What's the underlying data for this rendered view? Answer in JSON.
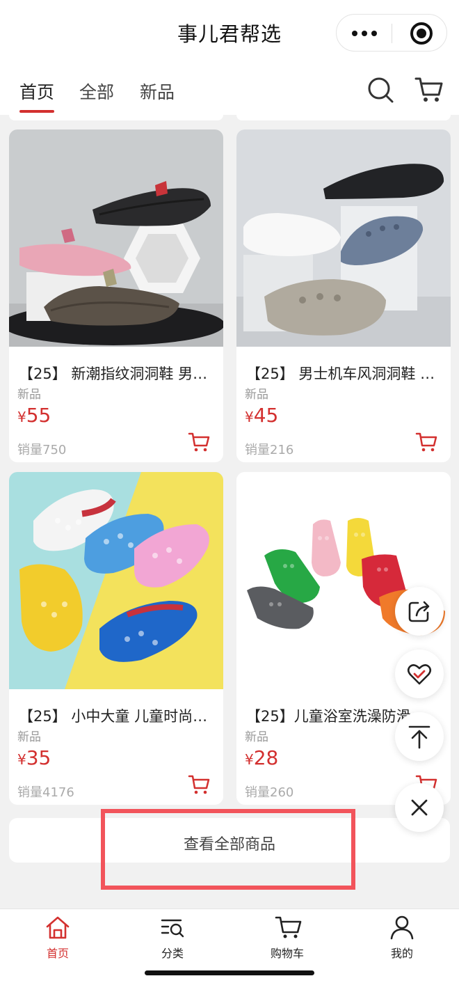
{
  "header": {
    "title": "事儿君帮选"
  },
  "tabs": [
    {
      "label": "首页",
      "active": true
    },
    {
      "label": "全部",
      "active": false
    },
    {
      "label": "新品",
      "active": false
    }
  ],
  "products": [
    {
      "name": "【25】 新潮指纹洞洞鞋 男…",
      "tag": "新品",
      "currency": "¥",
      "price": "55",
      "sales": "销量750"
    },
    {
      "name": "【25】 男士机车风洞洞鞋 …",
      "tag": "新品",
      "currency": "¥",
      "price": "45",
      "sales": "销量216"
    },
    {
      "name": "【25】 小中大童 儿童时尚…",
      "tag": "新品",
      "currency": "¥",
      "price": "35",
      "sales": "销量4176"
    },
    {
      "name": "【25】儿童浴室洗澡防滑",
      "tag": "新品",
      "currency": "¥",
      "price": "28",
      "sales": "销量260"
    }
  ],
  "view_all_label": "查看全部商品",
  "bottom_nav": [
    {
      "label": "首页",
      "icon": "home-icon",
      "active": true
    },
    {
      "label": "分类",
      "icon": "category-icon",
      "active": false
    },
    {
      "label": "购物车",
      "icon": "cart-icon",
      "active": false
    },
    {
      "label": "我的",
      "icon": "profile-icon",
      "active": false
    }
  ],
  "floating_actions": [
    "share-icon",
    "favorite-icon",
    "back-to-top-icon",
    "close-icon"
  ],
  "colors": {
    "accent": "#d3302f",
    "highlight_box": "#f2545b",
    "page_bg": "#f1f1f1"
  }
}
